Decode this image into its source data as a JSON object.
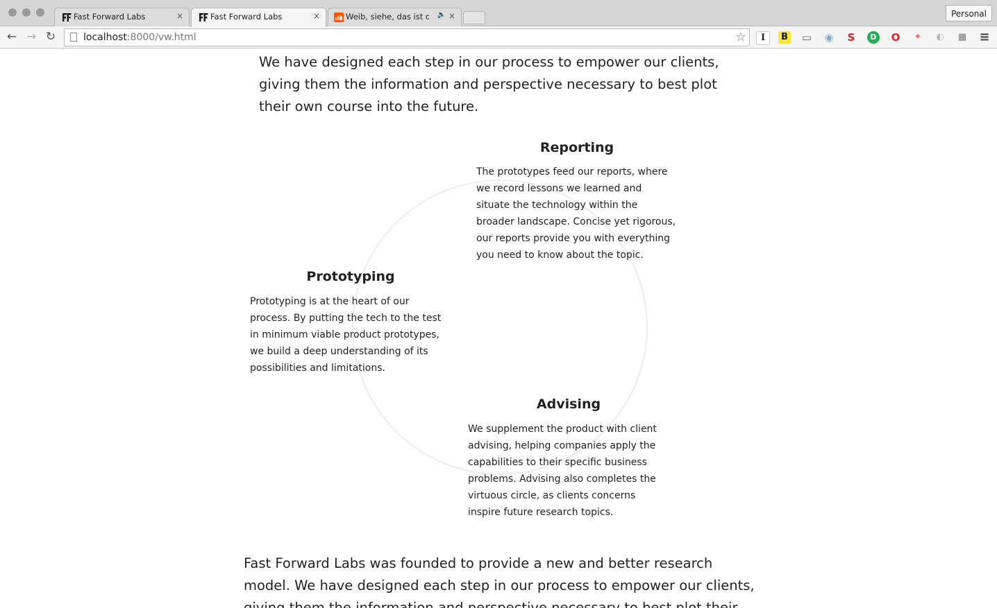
{
  "browser": {
    "tabs": [
      {
        "title": "Fast Forward Labs",
        "close": "×"
      },
      {
        "title": "Fast Forward Labs",
        "close": "×"
      },
      {
        "title": "Weib, siehe, das ist dein",
        "close": "×"
      }
    ],
    "profile_label": "Personal",
    "nav": {
      "back": "←",
      "forward": "→",
      "reload": "↻"
    },
    "url": {
      "host": "localhost",
      "rest": ":8000/vw.html"
    },
    "bookmark_star": "☆",
    "extensions": [
      {
        "name": "instapaper-icon",
        "glyph": "I"
      },
      {
        "name": "bold-b-icon",
        "glyph": "B"
      },
      {
        "name": "cast-icon",
        "glyph": "▭"
      },
      {
        "name": "camera-icon",
        "glyph": "◉"
      },
      {
        "name": "s-logo-icon",
        "glyph": "S"
      },
      {
        "name": "d-circle-icon",
        "glyph": "D"
      },
      {
        "name": "opera-icon",
        "glyph": "O"
      },
      {
        "name": "bird-icon",
        "glyph": "✦"
      },
      {
        "name": "leaf-icon",
        "glyph": "◐"
      },
      {
        "name": "puzzle-icon",
        "glyph": "▦"
      },
      {
        "name": "menu-icon",
        "glyph": "≡"
      }
    ]
  },
  "page": {
    "intro": "We have designed each step in our process to empower our clients, giving them the information and perspective necessary to best plot their own course into the future.",
    "steps": {
      "reporting": {
        "title": "Reporting",
        "body": "The prototypes feed our reports, where we record lessons we learned and situate the technology within the broader landscape. Concise yet rigorous, our reports provide you with everything you need to know about the topic."
      },
      "prototyping": {
        "title": "Prototyping",
        "body": "Prototyping is at the heart of our process. By putting the tech to the test in minimum viable product prototypes, we build a deep understanding of its possibilities and limitations."
      },
      "advising": {
        "title": "Advising",
        "body": "We supplement the product with client advising, helping companies apply the capabilities to their specific business problems. Advising also completes the virtuous circle, as clients concerns inspire future research topics."
      }
    },
    "closing": "Fast Forward Labs was founded to provide a new and better research model. We have designed each step in our process to empower our clients, giving them the information and perspective necessary to best plot their"
  },
  "colors": {
    "tab_strip": "#d6d6d6",
    "soundcloud_orange": "#ff5500",
    "circle_stroke": "#ececec",
    "text": "#222222"
  }
}
